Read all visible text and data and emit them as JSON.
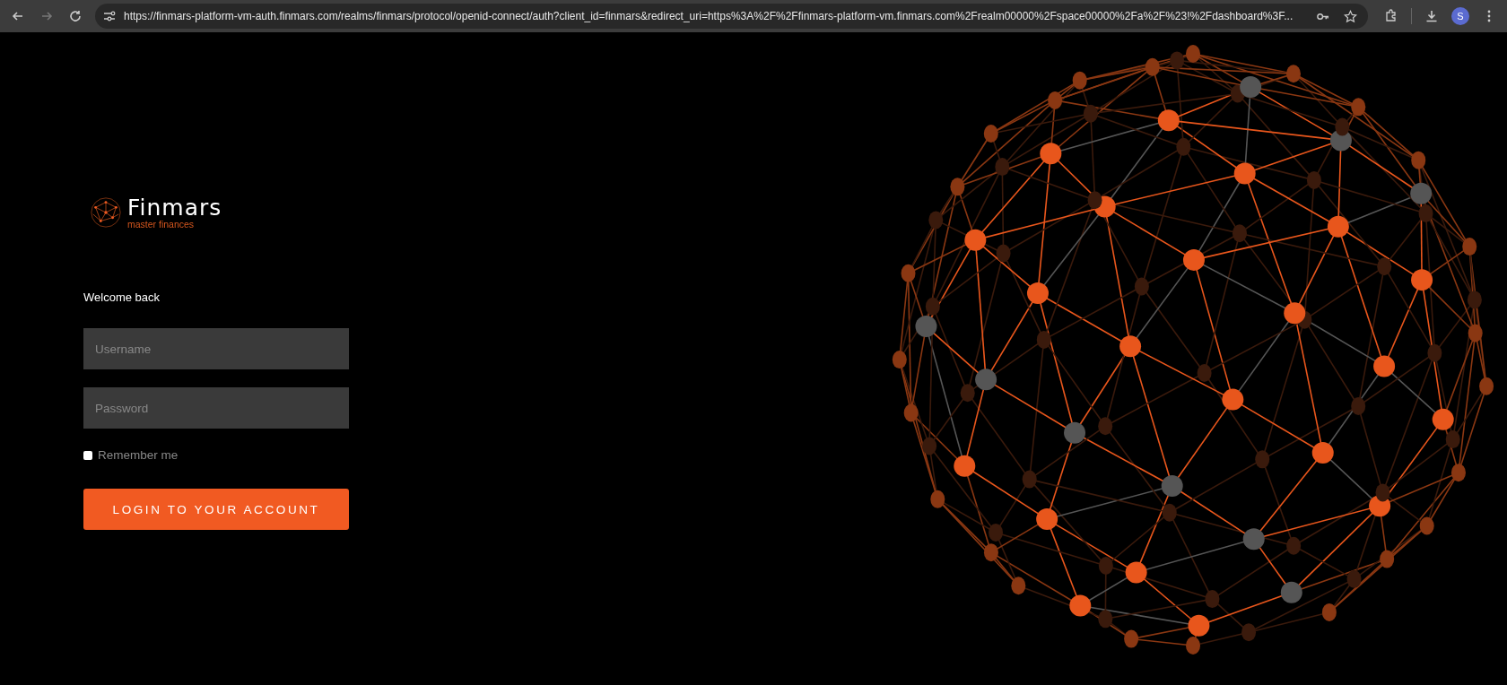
{
  "browser": {
    "url": "https://finmars-platform-vm-auth.finmars.com/realms/finmars/protocol/openid-connect/auth?client_id=finmars&redirect_uri=https%3A%2F%2Ffinmars-platform-vm.finmars.com%2Frealm00000%2Fspace00000%2Fa%2F%23!%2Fdashboard%3F...",
    "profile_initial": "S"
  },
  "logo": {
    "name": "Finmars",
    "tagline": "master finances"
  },
  "form": {
    "heading": "Welcome back",
    "fields": [
      {
        "placeholder": "Username"
      },
      {
        "placeholder": "Password"
      }
    ],
    "remember": {
      "label": "Remember me",
      "checked": false
    },
    "submit": "LOGIN TO YOUR ACCOUNT"
  }
}
